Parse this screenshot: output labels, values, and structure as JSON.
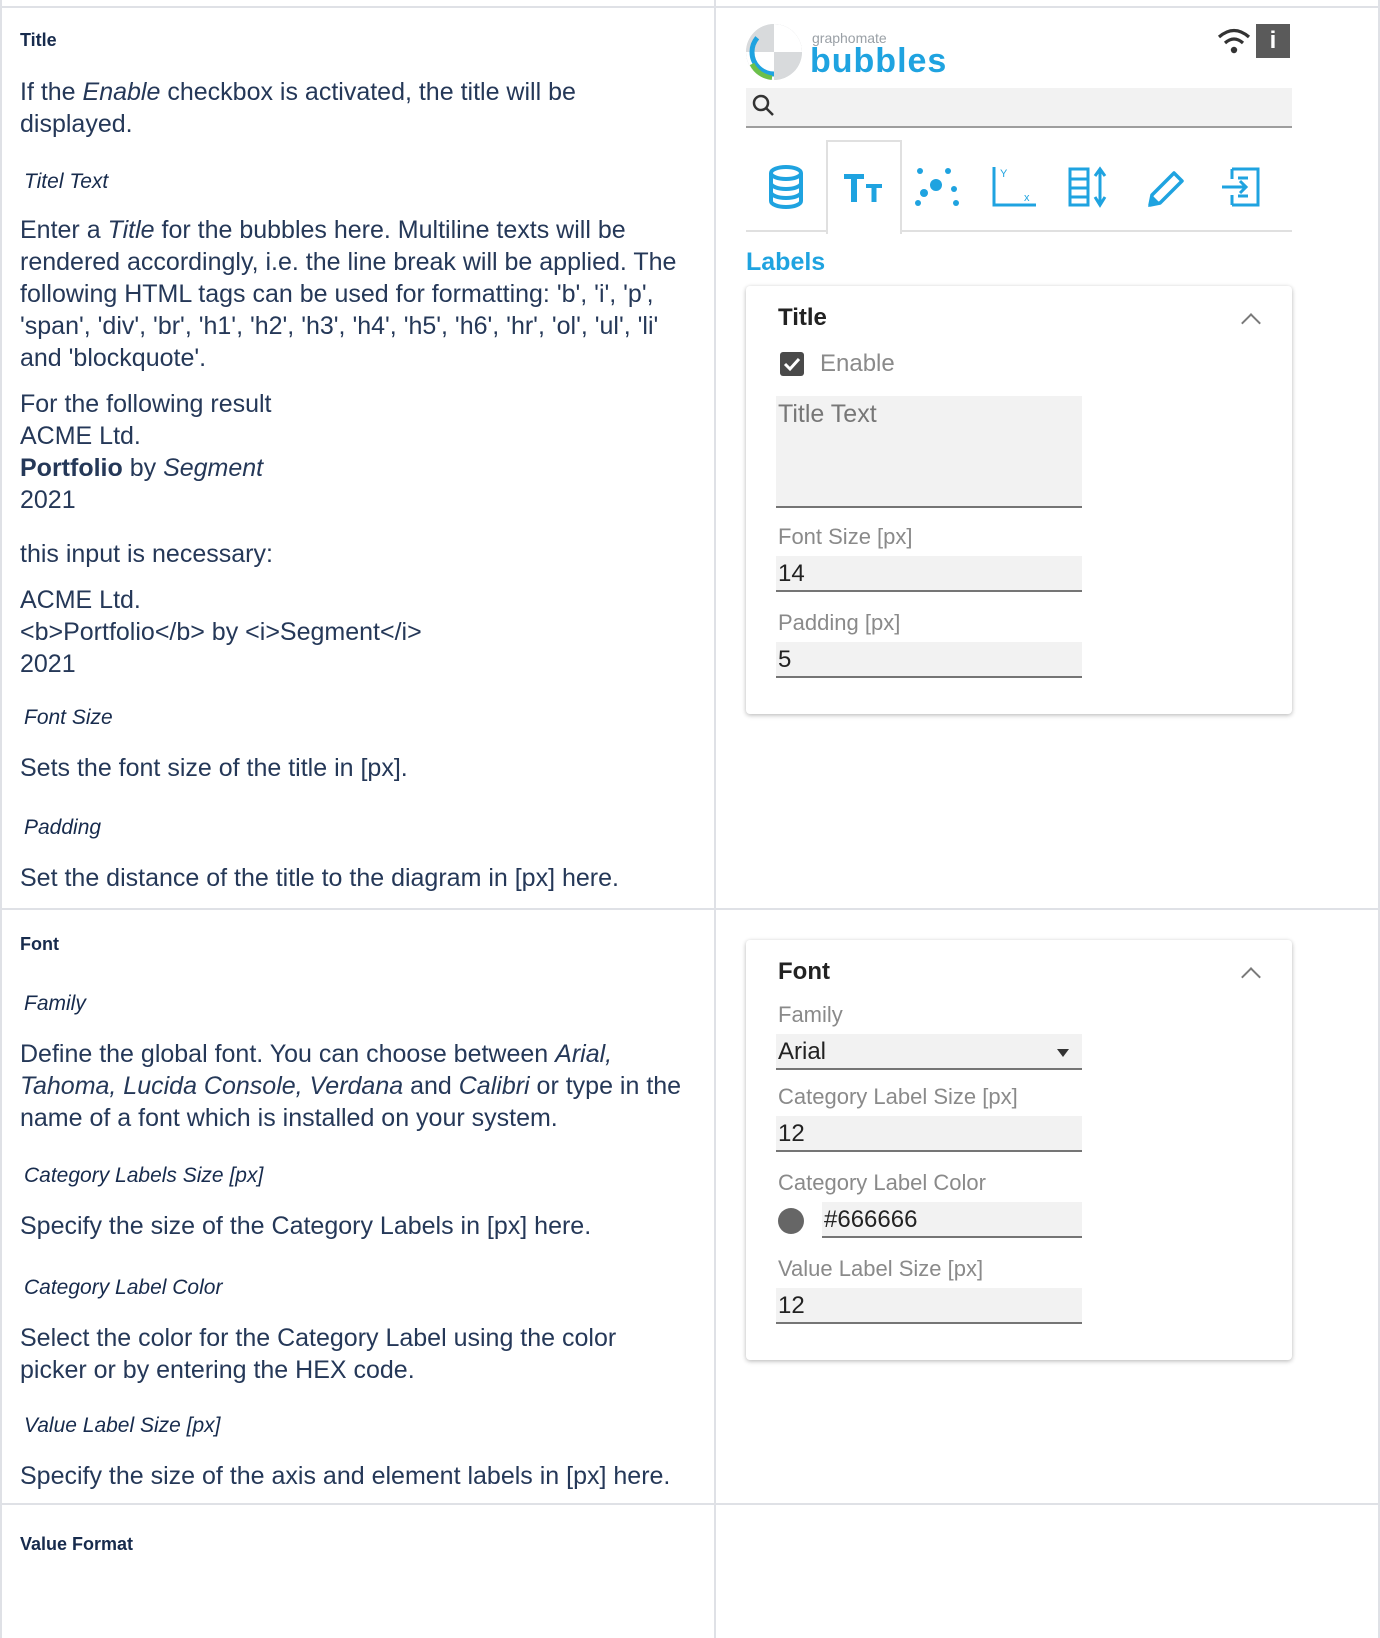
{
  "title_section": {
    "heading": "Title",
    "intro_pre": "If the ",
    "intro_italic": "Enable",
    "intro_post": " checkbox is activated, the title will be displayed.",
    "text_label": "Titel Text",
    "text_desc_pre": "Enter a ",
    "text_desc_italic": "Title",
    "text_desc_post": " for the bubbles here. Multiline texts will be rendered accordingly, i.e. the line break will be applied. The following HTML tags can be used for formatting: 'b', 'i', 'p', 'span', 'div', 'br', 'h1', 'h2', 'h3', 'h4', 'h5', 'h6', 'hr', 'ol', 'ul', 'li' and 'blockquote'.",
    "result_intro": "For the following result",
    "result_line1": "ACME Ltd.",
    "result_bold": "Portfolio",
    "result_by": " by ",
    "result_italic": "Segment",
    "result_year": "2021",
    "input_intro": "this input is necessary:",
    "input_line1": "ACME Ltd.",
    "input_line2": "<b>Portfolio</b> by <i>Segment</i>",
    "input_line3": "2021",
    "font_size_label": "Font Size",
    "font_size_desc": "Sets the font size of the title in [px].",
    "padding_label": "Padding",
    "padding_desc": "Set the distance of the title to the diagram in [px] here."
  },
  "font_section": {
    "heading": "Font",
    "family_label": "Family",
    "family_desc_pre": "Define the global font. You can choose between ",
    "family_desc_italic": "Arial, Tahoma, Lucida Console, Verdana",
    "family_desc_and": " and ",
    "family_desc_italic2": "Calibri",
    "family_desc_post": " or type in the name of a font which is installed on your system.",
    "cat_size_label": "Category Labels Size [px]",
    "cat_size_desc": "Specify the size of the Category Labels in [px] here.",
    "cat_color_label": "Category Label Color",
    "cat_color_desc": "Select the color for the Category Label using the color picker or by entering the HEX code.",
    "val_size_label": "Value Label Size [px]",
    "val_size_desc": "Specify the size of the axis and element labels in [px] here."
  },
  "value_format_section": {
    "heading": "Value Format"
  },
  "panel": {
    "logo_small": "graphomate",
    "logo_big": "bubbles",
    "info_icon": "i",
    "section_label": "Labels",
    "title_card": {
      "title": "Title",
      "enable_label": "Enable",
      "enable_checked": true,
      "title_text_placeholder": "Title Text",
      "font_size_label": "Font Size [px]",
      "font_size_value": "14",
      "padding_label": "Padding [px]",
      "padding_value": "5"
    },
    "font_card": {
      "title": "Font",
      "family_label": "Family",
      "family_value": "Arial",
      "cat_size_label": "Category Label Size [px]",
      "cat_size_value": "12",
      "cat_color_label": "Category Label Color",
      "cat_color_value": "#666666",
      "val_size_label": "Value Label Size [px]",
      "val_size_value": "12"
    },
    "colors": {
      "accent": "#1fa3e0",
      "logo_text": "#1fa3e0",
      "swatch": "#666666",
      "checkbox": "#4a4a4a"
    }
  }
}
